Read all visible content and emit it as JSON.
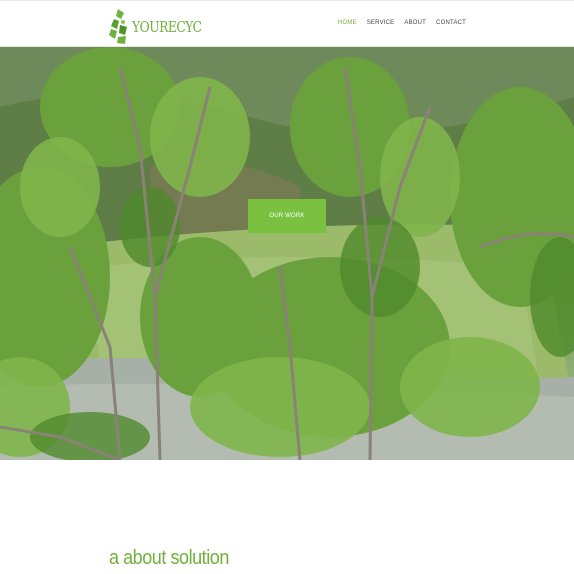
{
  "brand": {
    "name": "YOURECYC",
    "accent": "#6fb13c",
    "icon": "recycle-icon"
  },
  "nav": {
    "items": [
      {
        "label": "HOME",
        "active": true
      },
      {
        "label": "SERVICE",
        "active": false
      },
      {
        "label": "ABOUT",
        "active": false
      },
      {
        "label": "CONTACT",
        "active": false
      }
    ]
  },
  "hero": {
    "cta_label": "OUR WORK",
    "cta_color": "#7ac142",
    "image": "eucalyptus-forest-valley-photo"
  },
  "about": {
    "title": "a about solution"
  }
}
